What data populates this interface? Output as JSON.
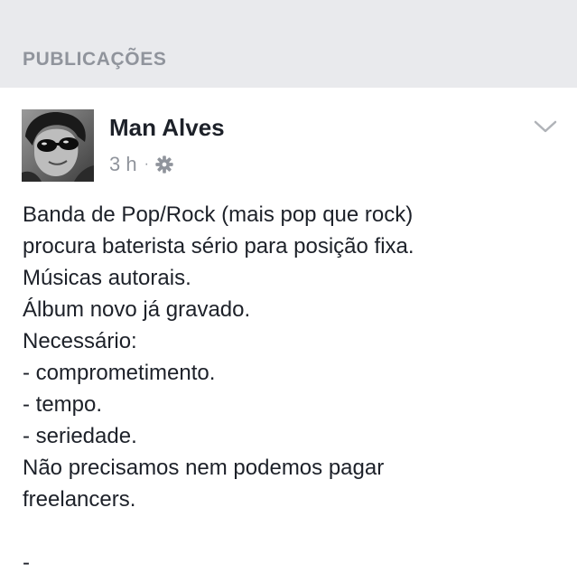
{
  "section": {
    "title": "PUBLICAÇÕES"
  },
  "post": {
    "author": "Man Alves",
    "time": "3 h",
    "separator": "·",
    "privacy_icon": "gear-icon",
    "menu_icon": "chevron-down-icon",
    "lines": [
      "Banda de Pop/Rock (mais pop que rock)",
      "procura baterista sério para posição fixa.",
      "Músicas autorais.",
      "Álbum novo já gravado.",
      "Necessário:",
      "- comprometimento.",
      "- tempo.",
      "- seriedade.",
      "Não precisamos nem podemos pagar",
      "freelancers.",
      "",
      "-"
    ]
  },
  "colors": {
    "header_bg": "#e9eaed",
    "muted_text": "#90949c",
    "body_text": "#1d2129"
  }
}
